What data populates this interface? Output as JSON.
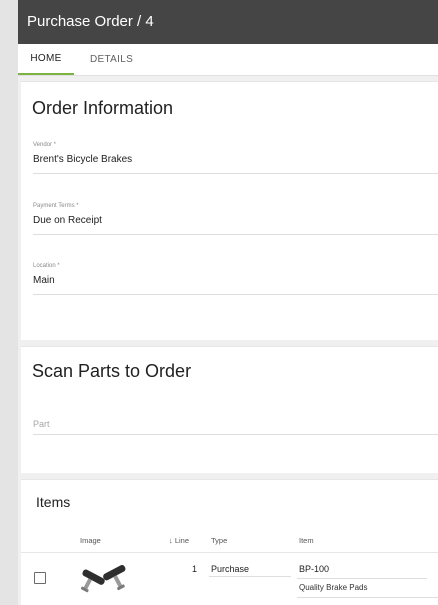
{
  "header": {
    "title": "Purchase Order / 4"
  },
  "tabs": [
    {
      "label": "HOME",
      "active": true
    },
    {
      "label": "DETAILS",
      "active": false
    }
  ],
  "order_info": {
    "title": "Order Information",
    "fields": [
      {
        "label": "Vendor *",
        "value": "Brent's Bicycle Brakes"
      },
      {
        "label": "Payment Terms *",
        "value": "Due on Receipt"
      },
      {
        "label": "Location *",
        "value": "Main"
      }
    ]
  },
  "scan": {
    "title": "Scan Parts to Order",
    "placeholder": "Part"
  },
  "items": {
    "title": "Items",
    "columns": {
      "image": "Image",
      "line": "Line",
      "type": "Type",
      "item": "Item"
    },
    "sort_icon": "arrow-down-icon",
    "rows": [
      {
        "line": "1",
        "type": "Purchase",
        "item": "BP-100",
        "description": "Quality Brake Pads",
        "image_icon": "brake-pads-image"
      }
    ]
  },
  "colors": {
    "titlebar": "#454545",
    "tab_indicator": "#7cb342",
    "background": "#f0f0f0"
  }
}
